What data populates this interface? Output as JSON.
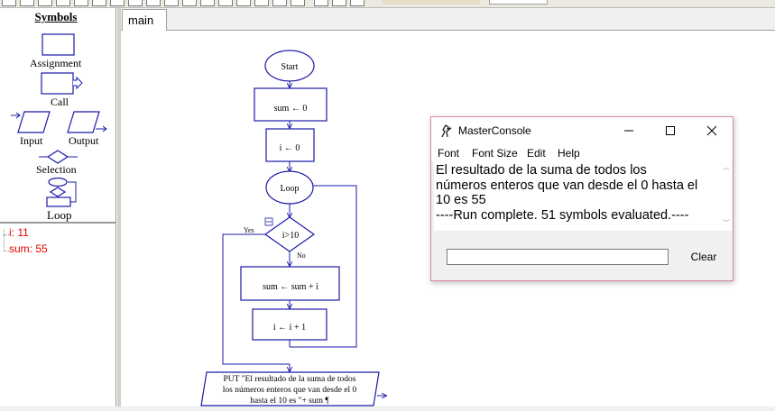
{
  "symbols_panel": {
    "title": "Symbols",
    "items": [
      {
        "label": "Assignment",
        "icon": "assignment-icon"
      },
      {
        "label": "Call",
        "icon": "call-icon"
      },
      {
        "label": "Input",
        "icon": "input-icon"
      },
      {
        "label": "Output",
        "icon": "output-icon"
      },
      {
        "label": "Selection",
        "icon": "selection-icon"
      },
      {
        "label": "Loop",
        "icon": "loop-icon"
      }
    ]
  },
  "variables": [
    {
      "text": "i: 11"
    },
    {
      "text": "sum: 55"
    }
  ],
  "tabs": [
    {
      "label": "main"
    }
  ],
  "flowchart": {
    "start": "Start",
    "assign_sum": "sum ← 0",
    "assign_i": "i ← 0",
    "loop": "Loop",
    "condition": "i>10",
    "yes": "Yes",
    "no": "No",
    "update_sum": "sum ← sum + i",
    "update_i": "i ← i + 1",
    "output_lines": [
      "PUT \"El resultado de la suma de todos",
      "los números enteros que van desde el 0",
      "hasta el 10 es \"+ sum ¶"
    ]
  },
  "console": {
    "title": "MasterConsole",
    "menu": [
      "Font",
      "Font Size",
      "Edit",
      "Help"
    ],
    "output_lines": [
      "El resultado de la suma de todos los",
      "números enteros que van desde el 0 hasta el",
      "10 es 55",
      "----Run complete.  51 symbols evaluated.----"
    ],
    "input_value": "",
    "clear_label": "Clear"
  },
  "colors": {
    "flow_blue": "#1a1aa8",
    "variable_red": "#e00000",
    "console_border": "#d98aa6"
  }
}
